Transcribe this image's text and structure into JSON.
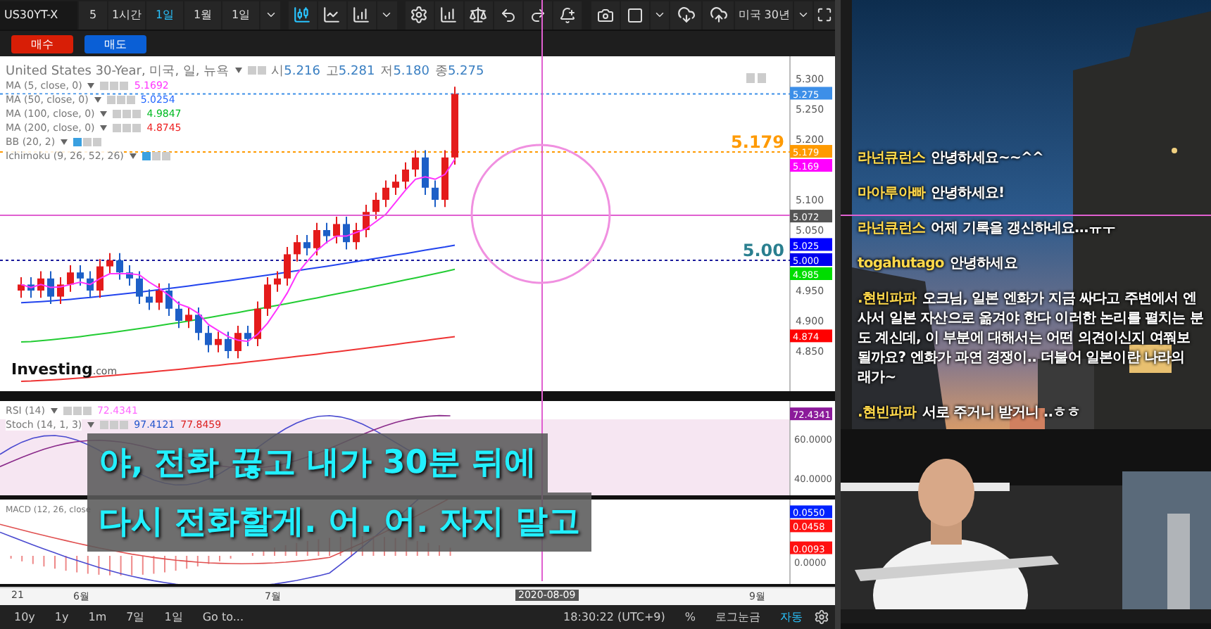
{
  "toolbar": {
    "symbol": "US30YT-X",
    "intervals": [
      {
        "label": "5",
        "selected": false
      },
      {
        "label": "1시간",
        "selected": false
      },
      {
        "label": "1일",
        "selected": true
      },
      {
        "label": "1월",
        "selected": false
      },
      {
        "label": "1일",
        "selected": false
      }
    ],
    "template": "미국 30년"
  },
  "trade_buttons": [
    {
      "label": "매수",
      "kind": "buy"
    },
    {
      "label": "매도",
      "kind": "sell"
    }
  ],
  "chart": {
    "title": "United States 30-Year, 미국, 일, 뉴욕",
    "ohlc": [
      {
        "label": "시",
        "value": "5.216"
      },
      {
        "label": "고",
        "value": "5.281"
      },
      {
        "label": "저",
        "value": "5.180"
      },
      {
        "label": "종",
        "value": "5.275"
      }
    ],
    "indicators": [
      {
        "name": "MA (5, close, 0)",
        "values": [
          {
            "text": "5.1692",
            "color": "#ff33ff"
          }
        ]
      },
      {
        "name": "MA (50, close, 0)",
        "values": [
          {
            "text": "5.0254",
            "color": "#2266ff"
          }
        ]
      },
      {
        "name": "MA (100, close, 0)",
        "values": [
          {
            "text": "4.9847",
            "color": "#00bb22"
          }
        ]
      },
      {
        "name": "MA (200, close, 0)",
        "values": [
          {
            "text": "4.8745",
            "color": "#ee2222"
          }
        ]
      },
      {
        "name": "BB (20, 2)"
      },
      {
        "name": "Ichimoku (9, 26, 52, 26)"
      }
    ],
    "price_ticks": [
      "5.300",
      "5.250",
      "5.200",
      "5.100",
      "5.050",
      "4.950",
      "4.900",
      "4.850"
    ],
    "price_tags": [
      {
        "value": "5.275",
        "color": "#3d8fe8",
        "line": true
      },
      {
        "value": "5.179",
        "color": "#ff9a00"
      },
      {
        "value": "5.169",
        "color": "#ff00ff"
      },
      {
        "value": "5.072",
        "color": "#555555"
      },
      {
        "value": "5.025",
        "color": "#0000ff"
      },
      {
        "value": "5.000",
        "color": "#0000ee"
      },
      {
        "value": "4.985",
        "color": "#00dd00"
      },
      {
        "value": "4.874",
        "color": "#ff0000"
      }
    ],
    "level_labels": [
      {
        "text": "5.179",
        "color": "#ff9a00"
      },
      {
        "text": "5.00",
        "color": "#2a7f8f"
      }
    ],
    "logo": {
      "main": "Investing",
      "suffix": ".com"
    }
  },
  "rsi_panel": {
    "indicators": [
      {
        "name": "RSI (14)",
        "values": [
          {
            "text": "72.4341",
            "color": "#ff66ff"
          }
        ]
      },
      {
        "name": "Stoch (14, 1, 3)",
        "values": [
          {
            "text": "97.4121",
            "color": "#2255cc"
          },
          {
            "text": "77.8459",
            "color": "#dd2222"
          }
        ]
      }
    ],
    "ticks": [
      "60.0000",
      "40.0000"
    ],
    "tags": [
      {
        "value": "72.4341",
        "color": "#8b1a9a"
      }
    ]
  },
  "macd_panel": {
    "indicators": [
      {
        "name": "MACD (12, 26, close"
      }
    ],
    "ticks": [
      "0.0000"
    ],
    "tags": [
      {
        "value": "0.0550",
        "color": "#0022ff"
      },
      {
        "value": "0.0458",
        "color": "#ff1111"
      },
      {
        "value": "0.0093",
        "color": "#ff1111"
      }
    ]
  },
  "date_axis": [
    {
      "label": "21",
      "selected": false
    },
    {
      "label": "6월",
      "selected": false
    },
    {
      "label": "7월",
      "selected": false
    },
    {
      "label": "2020-08-09",
      "selected": true
    },
    {
      "label": "9월",
      "selected": false
    }
  ],
  "bottom_bar": {
    "ranges": [
      "10y",
      "1y",
      "1m",
      "7일",
      "1일"
    ],
    "goto": "Go to...",
    "time": "18:30:22 (UTC+9)",
    "options": [
      {
        "label": "%",
        "selected": false
      },
      {
        "label": "로그눈금",
        "selected": false
      },
      {
        "label": "자동",
        "selected": true
      }
    ]
  },
  "subtitles": [
    "야, 전화 끊고 내가 30분 뒤에",
    "다시 전화할게. 어. 어. 자지 말고"
  ],
  "chat": [
    {
      "user": "라넌큐런스",
      "lines": [
        "안녕하세요~~^^"
      ]
    },
    {
      "user": "마아루아빠",
      "lines": [
        "안녕하세요!"
      ]
    },
    {
      "user": "라넌큐런스",
      "lines": [
        "어제 기록을 갱신하네요…ㅠㅜ"
      ]
    },
    {
      "user": "togahutago",
      "lines": [
        "안녕하세요"
      ]
    },
    {
      "user": ".현빈파파",
      "lines": [
        "오크님, 일본 엔화가 지금 싸다고 주변에서 엔",
        "사서 일본 자산으로 옮겨야 한다 이러한 논리를 펼치는 분",
        "도 계신데, 이 부분에 대해서는 어떤 의견이신지 여쭤보",
        "될까요? 엔화가 과연 경쟁이.. 더불어 일본이란 나라의",
        "래가~"
      ]
    },
    {
      "user": ".현빈파파",
      "lines": [
        "서로 주거니 받거니 ..ㅎㅎ"
      ]
    }
  ]
}
